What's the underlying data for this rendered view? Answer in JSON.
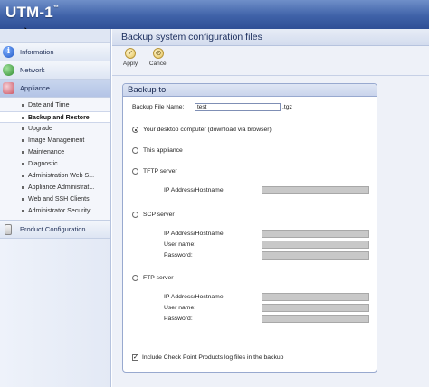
{
  "header": {
    "logo_text": "UTM-1",
    "logo_mark": "™"
  },
  "sidebar": {
    "sections": [
      {
        "label": "Information",
        "icon": "info-icon"
      },
      {
        "label": "Network",
        "icon": "network-icon"
      },
      {
        "label": "Appliance",
        "icon": "appliance-icon"
      }
    ],
    "appliance_items": [
      {
        "label": "Date and Time"
      },
      {
        "label": "Backup and Restore"
      },
      {
        "label": "Upgrade"
      },
      {
        "label": "Image Management"
      },
      {
        "label": "Maintenance"
      },
      {
        "label": "Diagnostic"
      },
      {
        "label": "Administration Web S..."
      },
      {
        "label": "Appliance Administrat..."
      },
      {
        "label": "Web and SSH Clients"
      },
      {
        "label": "Administrator Security"
      }
    ],
    "product_config": {
      "label": "Product Configuration",
      "icon": "document-icon"
    }
  },
  "main": {
    "title": "Backup system configuration files",
    "toolbar": {
      "apply_label": "Apply",
      "cancel_label": "Cancel"
    },
    "panel": {
      "heading": "Backup to",
      "file_name_label": "Backup File Name:",
      "file_name_value": "test",
      "file_suffix": ".tgz",
      "opt_desktop": "Your desktop computer (download via browser)",
      "opt_appliance": "This appliance",
      "opt_tftp": "TFTP server",
      "opt_scp": "SCP server",
      "opt_ftp": "FTP server",
      "ip_label": "IP Address/Hostname:",
      "user_label": "User name:",
      "pass_label": "Password:",
      "include_logs_label": "Include Check Point Products log files in the backup",
      "selected_option": "desktop",
      "include_logs_checked": true
    }
  },
  "colors": {
    "header_blue": "#3f62a8",
    "panel_border": "#98a9cf",
    "disabled_input": "#c8c8c8"
  }
}
